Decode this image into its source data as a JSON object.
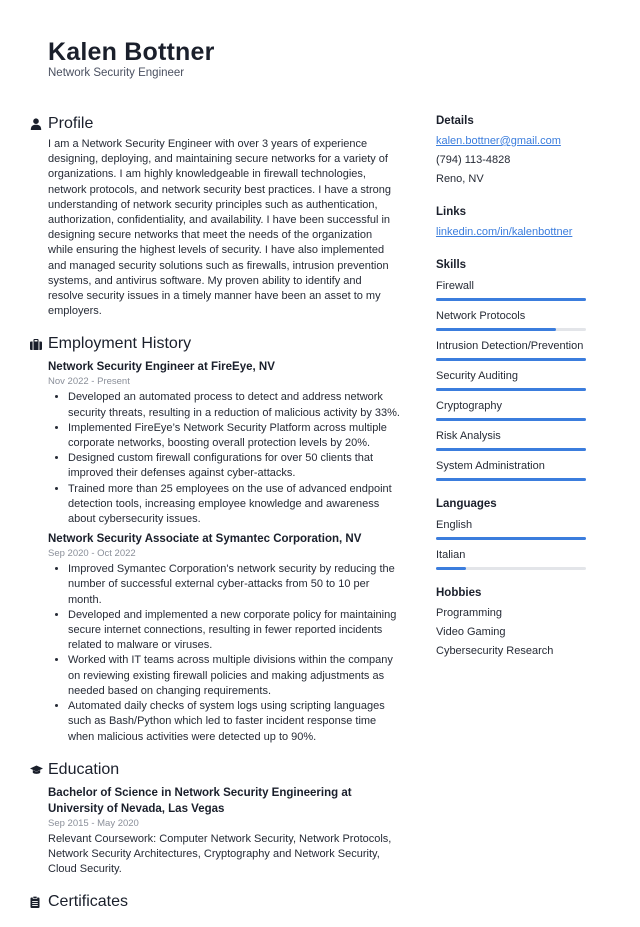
{
  "header": {
    "name": "Kalen Bottner",
    "title": "Network Security Engineer"
  },
  "profile": {
    "heading": "Profile",
    "icon": "person-icon",
    "text": "I am a Network Security Engineer with over 3 years of experience designing, deploying, and maintaining secure networks for a variety of organizations. I am highly knowledgeable in firewall technologies, network protocols, and network security best practices. I have a strong understanding of network security principles such as authentication, authorization, confidentiality, and availability. I have been successful in designing secure networks that meet the needs of the organization while ensuring the highest levels of security. I have also implemented and managed security solutions such as firewalls, intrusion prevention systems, and antivirus software. My proven ability to identify and resolve security issues in a timely manner have been an asset to my employers."
  },
  "employment": {
    "heading": "Employment History",
    "icon": "briefcase-icon",
    "jobs": [
      {
        "title": "Network Security Engineer at FireEye, NV",
        "date": "Nov 2022 - Present",
        "bullets": [
          "Developed an automated process to detect and address network security threats, resulting in a reduction of malicious activity by 33%.",
          "Implemented FireEye’s Network Security Platform across multiple corporate networks, boosting overall protection levels by 20%.",
          "Designed custom firewall configurations for over 50 clients that improved their defenses against cyber-attacks.",
          "Trained more than 25 employees on the use of advanced endpoint detection tools, increasing employee knowledge and awareness about cybersecurity issues."
        ]
      },
      {
        "title": "Network Security Associate at Symantec Corporation, NV",
        "date": "Sep 2020 - Oct 2022",
        "bullets": [
          "Improved Symantec Corporation's network security by reducing the number of successful external cyber-attacks from 50 to 10 per month.",
          "Developed and implemented a new corporate policy for maintaining secure internet connections, resulting in fewer reported incidents related to malware or viruses.",
          "Worked with IT teams across multiple divisions within the company on reviewing existing firewall policies and making adjustments as needed based on changing requirements.",
          "Automated daily checks of system logs using scripting languages such as Bash/Python which led to faster incident response time when malicious activities were detected up to 90%."
        ]
      }
    ]
  },
  "education": {
    "heading": "Education",
    "icon": "graduation-cap-icon",
    "degree": "Bachelor of Science in Network Security Engineering at University of Nevada, Las Vegas",
    "date": "Sep 2015 - May 2020",
    "description": "Relevant Coursework: Computer Network Security, Network Protocols, Network Security Architectures, Cryptography and Network Security, Cloud Security."
  },
  "certificates": {
    "heading": "Certificates",
    "icon": "clipboard-icon"
  },
  "details": {
    "heading": "Details",
    "email": "kalen.bottner@gmail.com",
    "phone": "(794) 113-4828",
    "location": "Reno, NV"
  },
  "links": {
    "heading": "Links",
    "items": [
      "linkedin.com/in/kalenbottner"
    ]
  },
  "skills": {
    "heading": "Skills",
    "items": [
      {
        "label": "Firewall",
        "level": 1.0
      },
      {
        "label": "Network Protocols",
        "level": 0.8
      },
      {
        "label": "Intrusion Detection/Prevention",
        "level": 1.0
      },
      {
        "label": "Security Auditing",
        "level": 1.0
      },
      {
        "label": "Cryptography",
        "level": 1.0
      },
      {
        "label": "Risk Analysis",
        "level": 1.0
      },
      {
        "label": "System Administration",
        "level": 1.0
      }
    ]
  },
  "languages": {
    "heading": "Languages",
    "items": [
      {
        "label": "English",
        "level": 1.0
      },
      {
        "label": "Italian",
        "level": 0.2
      }
    ]
  },
  "hobbies": {
    "heading": "Hobbies",
    "items": [
      "Programming",
      "Video Gaming",
      "Cybersecurity Research"
    ]
  },
  "colors": {
    "accent": "#3b7ddd",
    "bar_track": "#e3e5e9",
    "text": "#1f2430",
    "muted": "#8a8f99"
  }
}
